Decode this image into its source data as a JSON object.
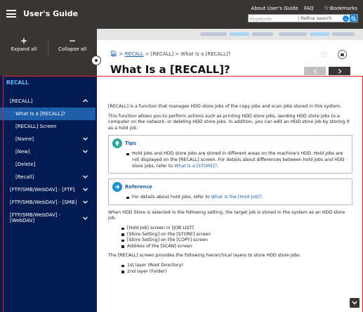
{
  "header": {
    "title": "User's Guide",
    "links": {
      "about": "About User's Guide",
      "faq": "FAQ",
      "bookmarks": "Bookmarks"
    },
    "search": {
      "placeholder": "Keywords...",
      "refine_label": "| Refine search"
    }
  },
  "sidebar_controls": {
    "expand_symbol": "+",
    "expand_label": "Expand all",
    "collapse_symbol": "−",
    "collapse_label": "Collapse all"
  },
  "sidebar": {
    "section_title": "RECALL",
    "items": [
      {
        "label": "[RECALL]",
        "icon": "chevron-up-icon"
      },
      {
        "label": "What Is a [RECALL]?"
      },
      {
        "label": "[RECALL] Screen"
      },
      {
        "label": "[Name]",
        "icon": "chevron-down-icon"
      },
      {
        "label": "[New]",
        "icon": "chevron-down-icon"
      },
      {
        "label": "[Delete]"
      },
      {
        "label": "[Recall]",
        "icon": "chevron-down-icon"
      },
      {
        "label": "[FTP/SMB/WebDAV] - [FTP]",
        "icon": "chevron-down-icon"
      },
      {
        "label": "[FTP/SMB/WebDAV] - [SMB]",
        "icon": "chevron-down-icon"
      },
      {
        "label": "[FTP/SMB/WebDAV] - [WebDAV]",
        "icon": "chevron-down-icon"
      }
    ]
  },
  "breadcrumb": {
    "home_icon": "home-icon",
    "sep1": ">",
    "link": "RECALL",
    "rest": "> [RECALL] > What Is a [RECALL]?"
  },
  "page": {
    "title": "What Is a [RECALL]?",
    "prev_label": "<",
    "next_label": ">"
  },
  "content": {
    "p1": "[RECALL] is a function that manages HDD store jobs of the copy jobs and scan jobs stored in this system.",
    "p2": "This function allows you to perform actions such as printing HDD store jobs, sending HDD store jobs to a computer on the network, or deleting HDD store jobs. In addition, you can edit an HDD store job by storing it as a hold job.",
    "tips": {
      "title": "Tips",
      "item_text": "Hold jobs and HDD store jobs are stored in different areas on the machine's HDD. Hold jobs are not displayed on the [RECALL] screen. For details about differences between hold jobs and HDD store jobs, refer to ",
      "item_link": "What Is a [STORE]?",
      "item_end": "."
    },
    "reference": {
      "title": "Reference",
      "item_text": "For details about hold jobs, refer to ",
      "item_link": "What Is the [Hold Job]?",
      "item_end": "."
    },
    "p3": "When HDD Store is selected in the following setting, the target job is stored in the system as an HDD store job.",
    "list1": [
      "[Hold Job] screen in [JOB LIST]",
      "[Store Setting] on the [STORE] screen",
      "[Store Setting] on the [COPY] screen",
      "Address of the [SCAN] screen"
    ],
    "p4": "The [RECALL] screen provides the following hierarchical layers to store HDD store jobs.",
    "list2": [
      "1st layer (Root Directory)",
      "2nd layer (Folder)"
    ]
  },
  "colors": {
    "header_bg": "#3a3533",
    "sidebar_bg": "#031b50",
    "selected_bg": "#1d5fa8",
    "link": "#1d5fa8",
    "highlight_frame": "#e02020"
  }
}
